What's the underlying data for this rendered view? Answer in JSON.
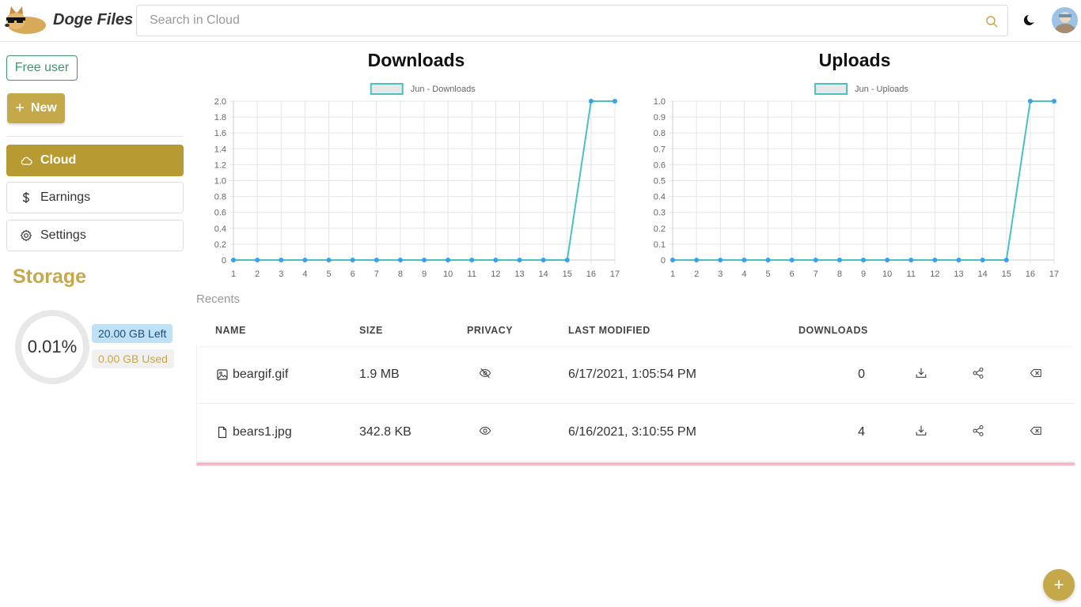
{
  "header": {
    "app_title": "Doge Files",
    "search_placeholder": "Search in Cloud",
    "search_value": ""
  },
  "sidebar": {
    "plan_badge": "Free user",
    "new_button": "New",
    "nav": [
      {
        "label": "Cloud",
        "icon": "cloud-icon",
        "active": true
      },
      {
        "label": "Earnings",
        "icon": "dollar-icon",
        "active": false
      },
      {
        "label": "Settings",
        "icon": "gear-icon",
        "active": false
      }
    ],
    "storage": {
      "title": "Storage",
      "percent_text": "0.01%",
      "percent_used": 0.0001,
      "left": "20.00 GB Left",
      "used": "0.00 GB Used"
    }
  },
  "colors": {
    "accent": "#c5a84a",
    "accent_dark": "#b89a32",
    "line": "#4bc0c0",
    "point": "#36a2eb",
    "free_user": "#3c9a6a"
  },
  "chart_data": [
    {
      "type": "line",
      "title": "Downloads",
      "series": [
        {
          "name": "Jun - Downloads",
          "values": [
            0,
            0,
            0,
            0,
            0,
            0,
            0,
            0,
            0,
            0,
            0,
            0,
            0,
            0,
            0,
            2,
            2
          ]
        }
      ],
      "x": [
        1,
        2,
        3,
        4,
        5,
        6,
        7,
        8,
        9,
        10,
        11,
        12,
        13,
        14,
        15,
        16,
        17
      ],
      "ylim": [
        0,
        2.0
      ],
      "yticks": [
        "0",
        "0.2",
        "0.4",
        "0.6",
        "0.8",
        "1.0",
        "1.2",
        "1.4",
        "1.6",
        "1.8",
        "2.0"
      ],
      "grid": true,
      "legend": "top"
    },
    {
      "type": "line",
      "title": "Uploads",
      "series": [
        {
          "name": "Jun - Uploads",
          "values": [
            0,
            0,
            0,
            0,
            0,
            0,
            0,
            0,
            0,
            0,
            0,
            0,
            0,
            0,
            0,
            1,
            1
          ]
        }
      ],
      "x": [
        1,
        2,
        3,
        4,
        5,
        6,
        7,
        8,
        9,
        10,
        11,
        12,
        13,
        14,
        15,
        16,
        17
      ],
      "ylim": [
        0,
        1.0
      ],
      "yticks": [
        "0",
        "0.1",
        "0.2",
        "0.3",
        "0.4",
        "0.5",
        "0.6",
        "0.7",
        "0.8",
        "0.9",
        "1.0"
      ],
      "grid": true,
      "legend": "top"
    }
  ],
  "recents": {
    "label": "Recents",
    "columns": {
      "name": "NAME",
      "size": "SIZE",
      "privacy": "PRIVACY",
      "modified": "LAST MODIFIED",
      "downloads": "DOWNLOADS"
    },
    "rows": [
      {
        "name": "beargif.gif",
        "file_icon": "image-icon",
        "size": "1.9 MB",
        "privacy": "eye-off-icon",
        "modified": "6/17/2021, 1:05:54 PM",
        "downloads": "0"
      },
      {
        "name": "bears1.jpg",
        "file_icon": "file-icon",
        "size": "342.8 KB",
        "privacy": "eye-icon",
        "modified": "6/16/2021, 3:10:55 PM",
        "downloads": "4"
      }
    ]
  },
  "fab": "+"
}
